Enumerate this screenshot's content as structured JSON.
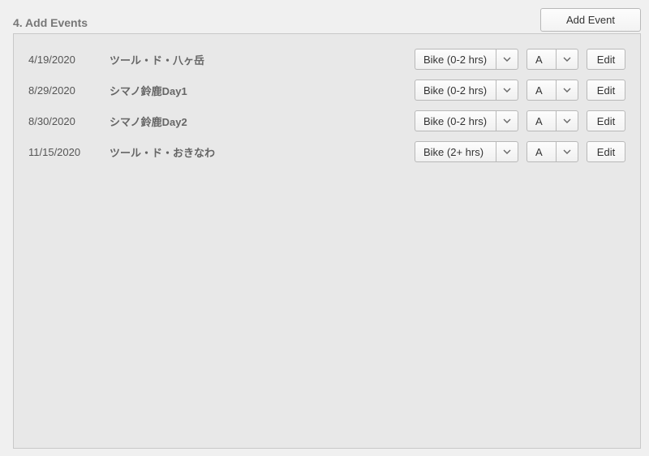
{
  "header": {
    "title": "4. Add Events",
    "add_button": "Add Event"
  },
  "labels": {
    "edit": "Edit"
  },
  "events": [
    {
      "date": "4/19/2020",
      "name": "ツール・ド・八ヶ岳",
      "type": "Bike (0-2 hrs)",
      "priority": "A"
    },
    {
      "date": "8/29/2020",
      "name": "シマノ鈴鹿Day1",
      "type": "Bike (0-2 hrs)",
      "priority": "A"
    },
    {
      "date": "8/30/2020",
      "name": "シマノ鈴鹿Day2",
      "type": "Bike (0-2 hrs)",
      "priority": "A"
    },
    {
      "date": "11/15/2020",
      "name": "ツール・ド・おきなわ",
      "type": "Bike (2+ hrs)",
      "priority": "A"
    }
  ]
}
